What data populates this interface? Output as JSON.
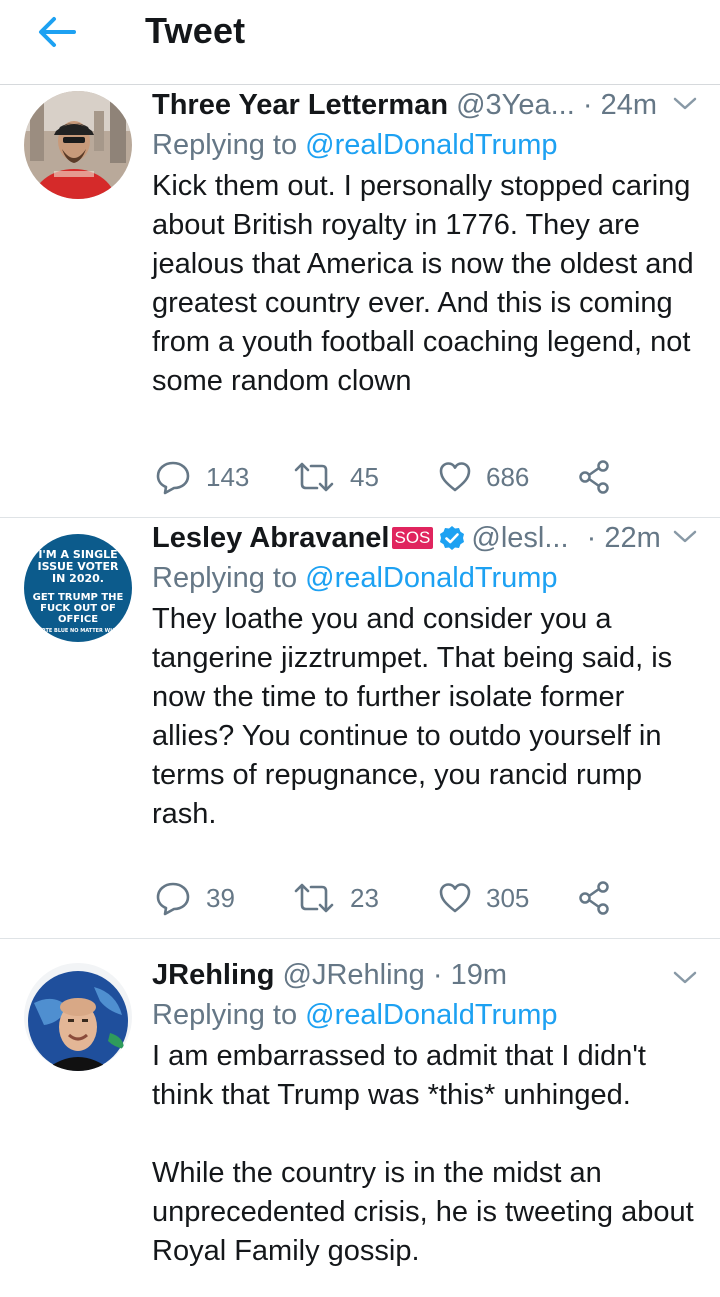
{
  "header": {
    "title": "Tweet",
    "back_icon": "arrow-left-icon",
    "accent_color": "#1da1f2"
  },
  "tweets": [
    {
      "name": "Three Year Letterman",
      "handle": "@3Yea...",
      "dot": "·",
      "time": "24m",
      "replying_prefix": "Replying to",
      "replying_to": "@realDonaldTrump",
      "text": "Kick them out. I personally stopped caring about British royalty in 1776. They are jealous that America is now the oldest and greatest country ever. And this is coming from a youth football coaching legend, not some random clown",
      "replies": "143",
      "retweets": "45",
      "likes": "686"
    },
    {
      "name": "Lesley Abravanel",
      "badge": "SOS",
      "verified": true,
      "handle": "@lesl...",
      "dot": "·",
      "time": "22m",
      "replying_prefix": "Replying to",
      "replying_to": "@realDonaldTrump",
      "text": "They loathe you and consider you a tangerine jizztrumpet. That being said, is now the time to further isolate former allies? You continue to outdo yourself in terms of repugnance, you rancid rump rash.",
      "replies": "39",
      "retweets": "23",
      "likes": "305",
      "avatar_text": {
        "line1": "I'M A SINGLE",
        "line2": "ISSUE VOTER",
        "line3": "IN 2020.",
        "line4": "GET TRUMP THE",
        "line5": "FUCK OUT OF",
        "line6": "OFFICE",
        "line7": "VOTE BLUE NO MATTER WHO"
      }
    },
    {
      "name": "JRehling",
      "handle": "@JRehling",
      "dot": "·",
      "time": "19m",
      "replying_prefix": "Replying to",
      "replying_to": "@realDonaldTrump",
      "text": "I am embarrassed to admit that I didn't think that Trump was *this* unhinged.\n\nWhile the country is in the midst an unprecedented crisis, he is tweeting about Royal Family gossip."
    }
  ],
  "icons": {
    "reply": "reply-icon",
    "retweet": "retweet-icon",
    "like": "heart-icon",
    "share": "share-icon",
    "more": "chevron-down-icon"
  },
  "colors": {
    "text": "#14171a",
    "secondary": "#657786",
    "link": "#1da1f2",
    "verified": "#1da1f2",
    "sos_badge": "#e0245e"
  }
}
